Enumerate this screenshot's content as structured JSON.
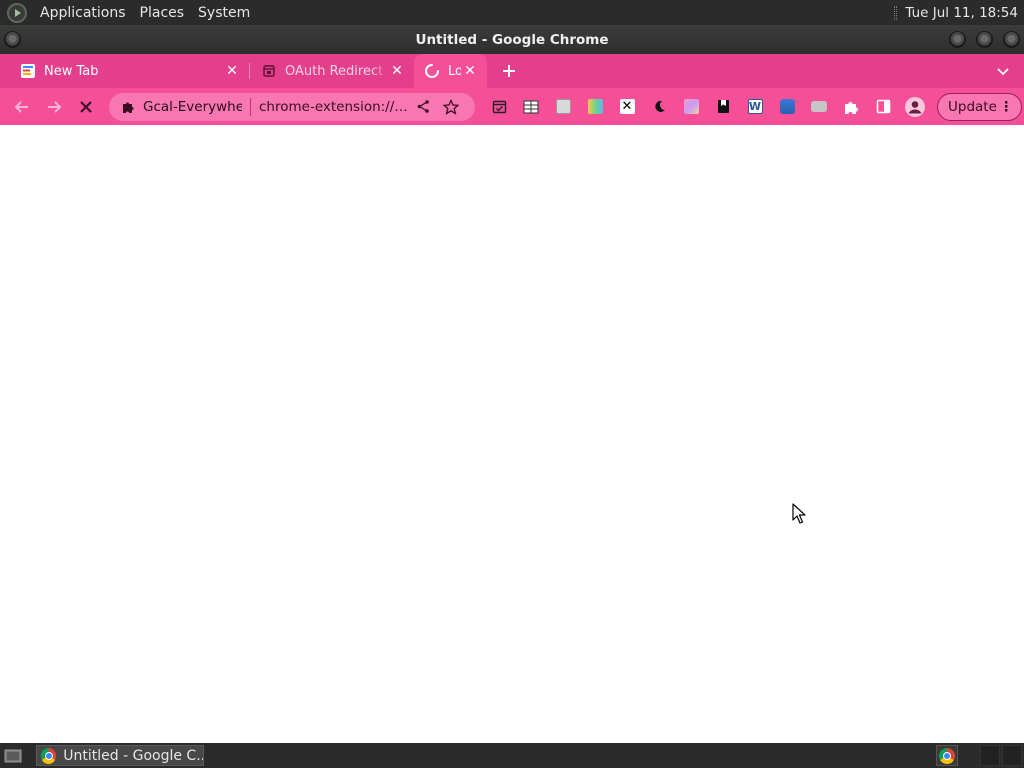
{
  "system_panel": {
    "menus": [
      "Applications",
      "Places",
      "System"
    ],
    "clock": "Tue Jul 11, 18:54"
  },
  "window": {
    "title": "Untitled - Google Chrome"
  },
  "tabs": [
    {
      "title": "New Tab",
      "state": "inactive"
    },
    {
      "title": "OAuth Redirect P",
      "state": "inactive"
    },
    {
      "title": "Lo",
      "state": "active-loading"
    }
  ],
  "toolbar": {
    "omnibox": {
      "chip": "Gcal-Everywher",
      "url": "chrome-extension://g..."
    },
    "extensions": [
      "calendar-check-icon",
      "table-icon",
      "screenshot-icon",
      "color-palette-icon",
      "x-icon",
      "moon-icon",
      "gradient-icon",
      "bookmark-icon",
      "word-icon",
      "media-icon",
      "toggle-icon",
      "puzzle-icon"
    ],
    "update_label": "Update"
  },
  "taskbar": {
    "task_title": "Untitled - Google C..."
  },
  "colors": {
    "accent": "#f54f98",
    "tabstrip": "#e43f8c",
    "panel": "#2b2b2b"
  }
}
